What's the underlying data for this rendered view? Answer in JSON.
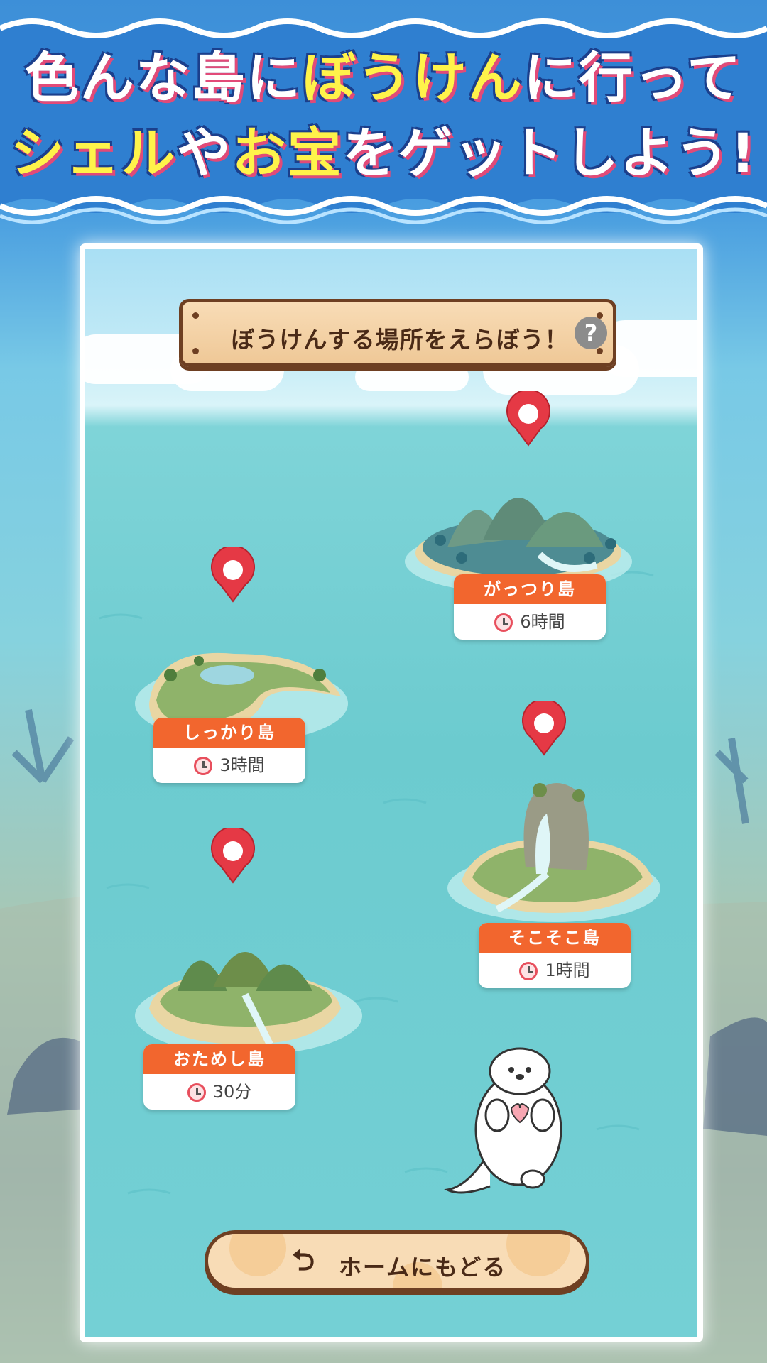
{
  "banner": {
    "line1": {
      "a": "色んな島に",
      "b": "ぼうけん",
      "c": "に行って"
    },
    "line2": {
      "a": "シェル",
      "b": "や",
      "c": "お宝",
      "d": "をゲットしよう!"
    }
  },
  "header": {
    "title": "ぼうけんする場所をえらぼう！",
    "help": "?"
  },
  "islands": [
    {
      "name": "がっつり島",
      "time": "6時間"
    },
    {
      "name": "しっかり島",
      "time": "3時間"
    },
    {
      "name": "そこそこ島",
      "time": "1時間"
    },
    {
      "name": "おためし島",
      "time": "30分"
    }
  ],
  "home_button": {
    "label": "ホームにもどる",
    "icon": "return-arrow-icon"
  },
  "colors": {
    "accent": "#f2662e",
    "board": "#f8dcb6",
    "board_border": "#6e3f22",
    "pin": "#e53945",
    "headline_highlight": "#fff34a"
  }
}
